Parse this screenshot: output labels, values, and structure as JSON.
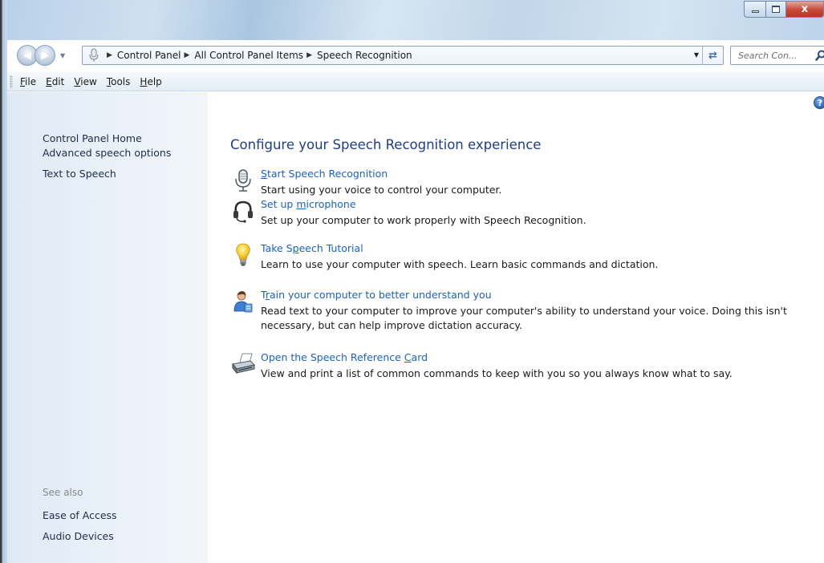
{
  "window": {
    "caption_buttons": {
      "minimize": "minimize",
      "maximize": "maximize",
      "close": "x"
    }
  },
  "address_bar": {
    "breadcrumbs": [
      {
        "label": "Control Panel"
      },
      {
        "label": "All Control Panel Items"
      },
      {
        "label": "Speech Recognition"
      }
    ]
  },
  "search": {
    "placeholder": "Search Con..."
  },
  "menu": {
    "items": [
      {
        "label": "File",
        "access_key": "F",
        "rest": "ile"
      },
      {
        "label": "Edit",
        "access_key": "E",
        "rest": "dit"
      },
      {
        "label": "View",
        "access_key": "V",
        "rest": "iew"
      },
      {
        "label": "Tools",
        "access_key": "T",
        "rest": "ools"
      },
      {
        "label": "Help",
        "access_key": "H",
        "rest": "elp"
      }
    ]
  },
  "left_pane": {
    "home_link": "Control Panel Home",
    "links": [
      "Advanced speech options",
      "Text to Speech"
    ],
    "see_also_label": "See also",
    "see_also_links": [
      "Ease of Access",
      "Audio Devices"
    ]
  },
  "main": {
    "title": "Configure your Speech Recognition experience",
    "tasks": [
      {
        "icon": "microphone-icon",
        "link_pre": "",
        "link_key": "S",
        "link_post": "tart Speech Recognition",
        "description": "Start using your voice to control your computer."
      },
      {
        "icon": "headset-icon",
        "link_pre": "Set up ",
        "link_key": "m",
        "link_post": "icrophone",
        "description": "Set up your computer to work properly with Speech Recognition."
      },
      {
        "icon": "lightbulb-icon",
        "link_pre": "Take S",
        "link_key": "p",
        "link_post": "eech Tutorial",
        "description": "Learn to use your computer with speech.  Learn basic commands and dictation."
      },
      {
        "icon": "user-training-icon",
        "link_pre": "T",
        "link_key": "r",
        "link_post": "ain your computer to better understand you",
        "description": "Read text to your computer to improve your computer's ability to understand your voice.  Doing this isn't necessary, but can help improve dictation accuracy."
      },
      {
        "icon": "printer-icon",
        "link_pre": "Open the Speech Reference ",
        "link_key": "C",
        "link_post": "ard",
        "description": "View and print a list of common commands to keep with you so you always know what to say."
      }
    ]
  },
  "colors": {
    "link": "#1a62c4",
    "title": "#1e3e8a",
    "left_pane": "#dfe9f5",
    "close_button": "#c8473a"
  }
}
